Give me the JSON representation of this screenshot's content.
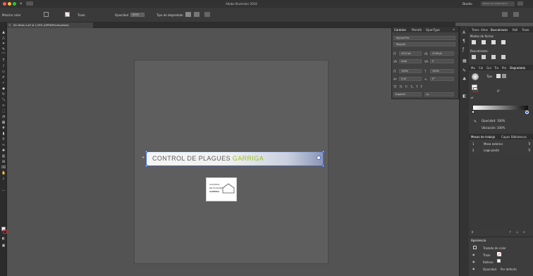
{
  "app": {
    "title": "Adobe Illustrator 2019"
  },
  "menubar": {
    "workspace_label": "Diseño",
    "colors": {
      "close": "#fe5f57",
      "minimize": "#febc2e",
      "zoom": "#28c840"
    }
  },
  "controlbar": {
    "selection_label": "Mezclar color",
    "stroke_label": "Trazo",
    "opacity_label": "Opacidad",
    "opacity_value": "100%",
    "blend_label": "Tipo de degradado"
  },
  "document": {
    "tab_title": "Sin título-1.ai* al 1,53% (CMYK/Previsualizar)"
  },
  "artboard": {
    "logo_text_main": "CONTROL DE PLAGUES",
    "logo_text_brand": "GARRIGA",
    "mini_logo_lines": [
      "CONTROL",
      "DE PLAGUES",
      "GARRIGA"
    ],
    "colors": {
      "brand_green": "#9bbf2a",
      "selection_blue": "#3f6cd8"
    }
  },
  "character_panel": {
    "tabs": [
      "Carácter",
      "Párrafo",
      "OpenType"
    ],
    "font_family": "Myriad Pro",
    "font_style": "Regular",
    "size": "4124 pt",
    "leading": "4748 pt",
    "kerning": "Auto",
    "tracking": "0",
    "vscale": "100%",
    "hscale": "100%",
    "baseline": "0 pt",
    "rotation": "0°",
    "language": "Español"
  },
  "right_panels": {
    "top_tabs": [
      "Trans",
      "Aline",
      "Buscatrazos",
      "Rell",
      "Trazo"
    ],
    "section_shape_modes": "Modos de forma:",
    "section_pathfinder": "Buscatrazos:",
    "gradient_tabs": [
      "Mu",
      "Col",
      "Gui",
      "Tra",
      "Pro",
      "Degradado"
    ],
    "gradient_type_label": "Tipo",
    "opacity_label": "Opacidad:",
    "opacity_value": "100%",
    "location_label": "Ubicación:",
    "location_value": "100%",
    "angle_value": "0°",
    "layers_tabs": [
      "Mesas de trabajo",
      "Capas",
      "Bibliotecas"
    ],
    "layers": [
      {
        "num": "1",
        "name": "Mesa exterior",
        "ext": "Tr"
      },
      {
        "num": "2",
        "name": "Logo poste",
        "ext": "Tr"
      }
    ],
    "appearance_title": "Apariencia",
    "appearance_rows": [
      {
        "label": "Trazado de color"
      },
      {
        "label": "Trazo"
      },
      {
        "label": "Relleno"
      },
      {
        "label": "Opacidad",
        "value": "Por defecto"
      }
    ]
  },
  "search": {
    "placeholder": "Buscar en Adobe Stock"
  }
}
